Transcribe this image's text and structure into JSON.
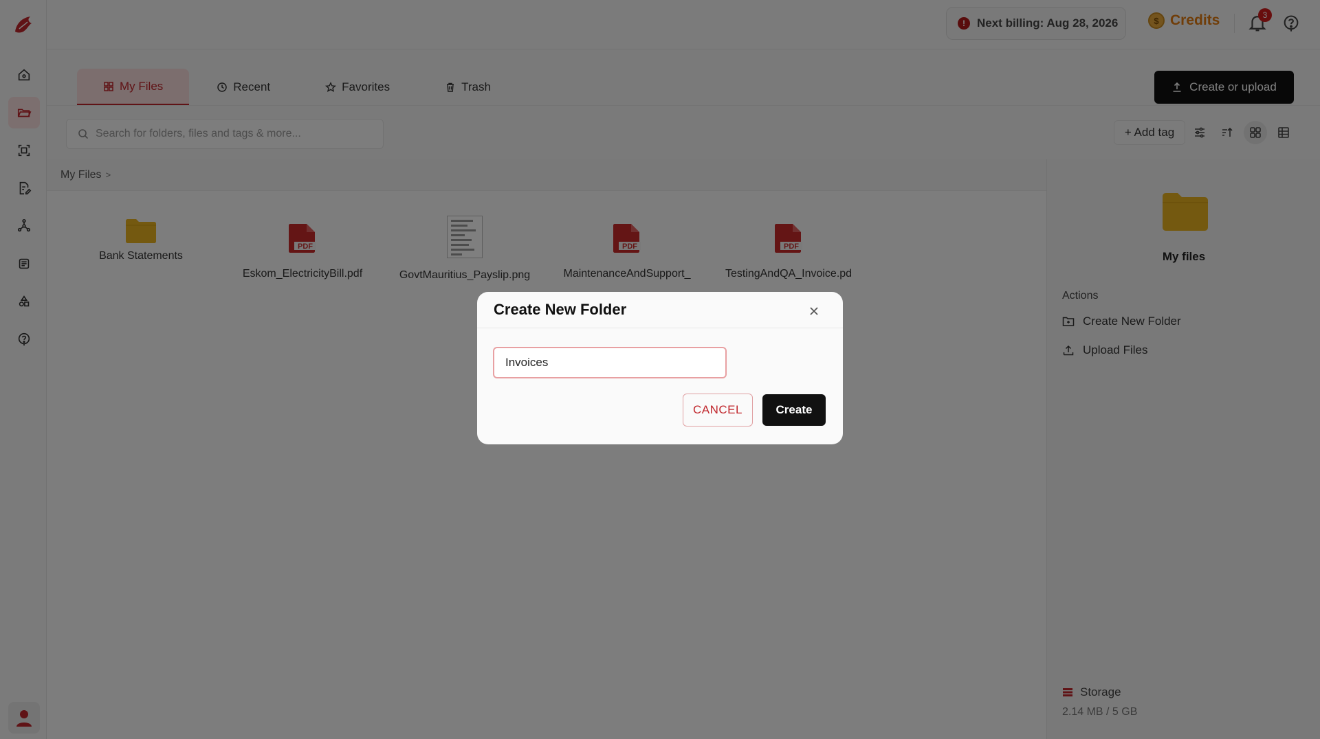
{
  "header": {
    "billing_text": "Next billing: Aug 28, 2026",
    "credits_label": "Credits",
    "notifications_count": "3"
  },
  "tabs": [
    {
      "label": "My Files"
    },
    {
      "label": "Recent"
    },
    {
      "label": "Favorites"
    },
    {
      "label": "Trash"
    }
  ],
  "toolbar": {
    "create_upload_label": "Create or upload",
    "search_placeholder": "Search for folders, files and tags & more...",
    "add_tag_label": "+ Add tag"
  },
  "breadcrumb": {
    "root": "My Files",
    "separator": ">"
  },
  "files": [
    {
      "name": "Bank Statements",
      "type": "folder"
    },
    {
      "name": "Eskom_ElectricityBill.pdf",
      "type": "pdf"
    },
    {
      "name": "GovtMauritius_Payslip.png",
      "type": "image"
    },
    {
      "name": "MaintenanceAndSupport_",
      "type": "pdf"
    },
    {
      "name": "TestingAndQA_Invoice.pd",
      "type": "pdf"
    }
  ],
  "right_panel": {
    "title": "My files",
    "actions_heading": "Actions",
    "actions": [
      {
        "label": "Create New Folder"
      },
      {
        "label": "Upload Files"
      }
    ],
    "storage_label": "Storage",
    "storage_value": "2.14 MB / 5 GB"
  },
  "modal": {
    "title": "Create New Folder",
    "input_value": "Invoices",
    "cancel_label": "CANCEL",
    "create_label": "Create"
  },
  "colors": {
    "brand": "#c0262c",
    "folder": "#e8b320",
    "pdf": "#c82a2a",
    "credits": "#e07a10"
  }
}
